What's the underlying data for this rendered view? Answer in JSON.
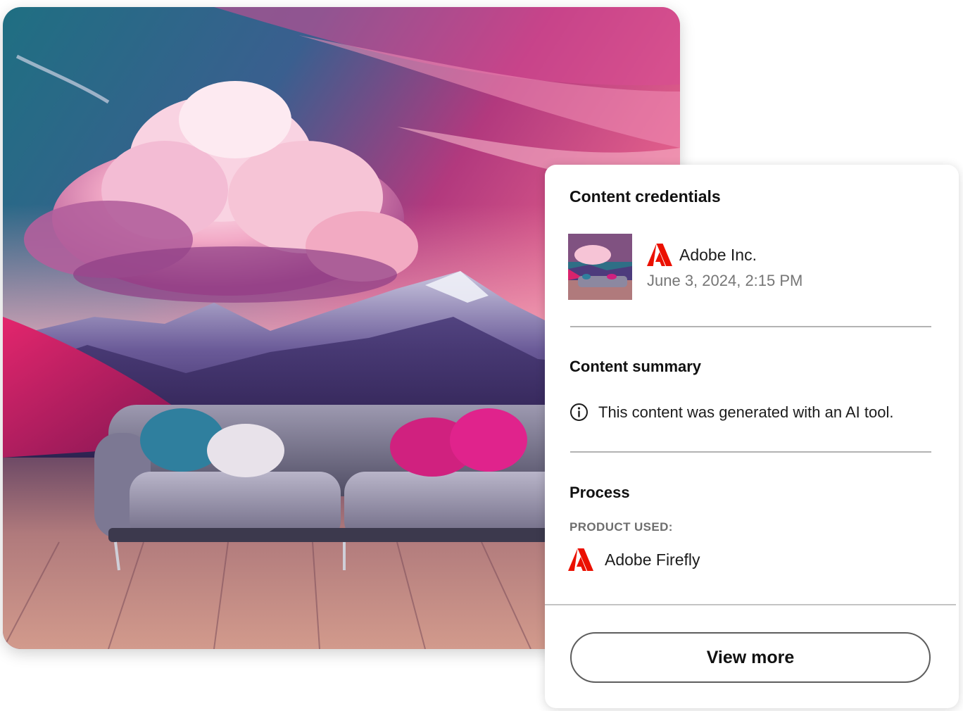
{
  "credentials": {
    "title": "Content credentials",
    "issuer": {
      "name": "Adobe Inc.",
      "date": "June 3, 2024, 2:15 PM",
      "logo_icon": "adobe-logo-icon"
    },
    "summary": {
      "title": "Content summary",
      "icon": "info-icon",
      "text": "This content was generated with an AI tool."
    },
    "process": {
      "title": "Process",
      "product_label": "PRODUCT USED:",
      "product_name": "Adobe Firefly",
      "product_icon": "adobe-logo-icon"
    },
    "view_more_label": "View more"
  },
  "colors": {
    "adobe_red": "#eb1000",
    "divider": "#b3b3b3",
    "muted_text": "#767676",
    "button_border": "#5e5e5e"
  }
}
